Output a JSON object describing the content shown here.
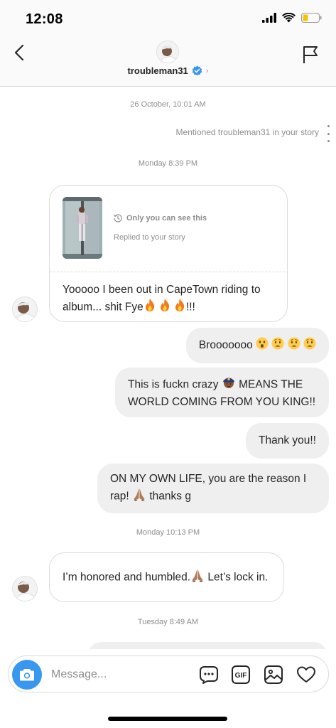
{
  "status_bar": {
    "time": "12:08"
  },
  "header": {
    "username": "troubleman31"
  },
  "chat": {
    "ts1": "26 October, 10:01 AM",
    "mention": "Mentioned troubleman31 in your story",
    "ts2": "Monday 8:39 PM",
    "story_reply": {
      "only_you": "Only you can see this",
      "replied": "Replied to your story",
      "text": "Yooooo I been out in CapeTown riding to album... shit Fye",
      "suffix": "!!!"
    },
    "msg_brooooo": "Brooooooo",
    "msg_crazy_a": "This is fuckn crazy",
    "msg_crazy_b": "MEANS THE WORLD COMING FROM YOU KING!!",
    "msg_thanks": "Thank you!!",
    "msg_own_life_a": "ON MY OWN LIFE, you are the reason I rap!",
    "msg_own_life_b": "thanks g",
    "ts3": "Monday 10:13 PM",
    "msg_honored_a": "I’m honored and humbled.",
    "msg_honored_b": "Let’s lock in.",
    "ts4": "Tuesday 8:49 AM"
  },
  "composer": {
    "placeholder": "Message...",
    "gif_label": "GIF"
  }
}
